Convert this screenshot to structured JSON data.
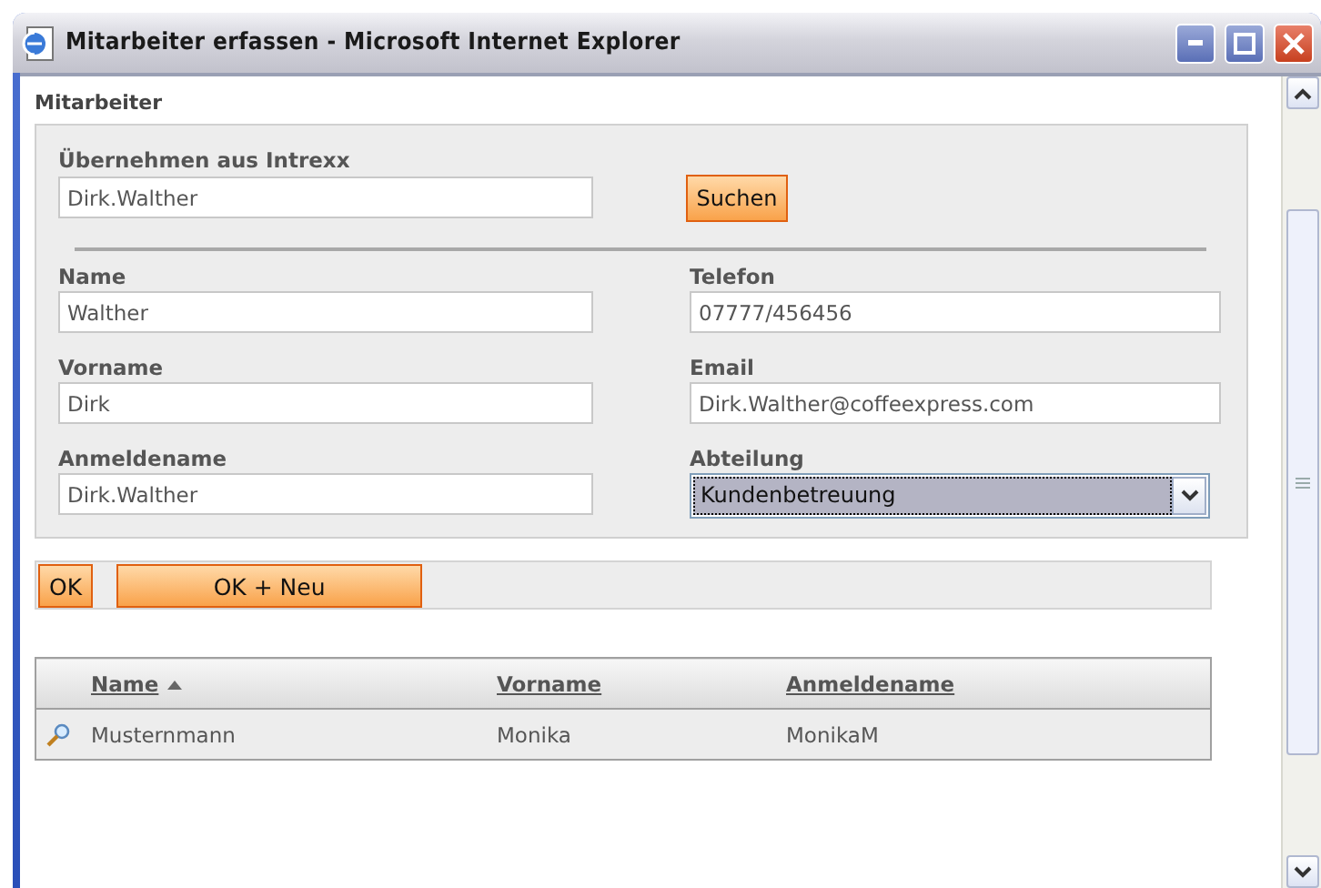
{
  "window": {
    "title": "Mitarbeiter erfassen - Microsoft Internet Explorer"
  },
  "section_title": "Mitarbeiter",
  "import": {
    "label": "Übernehmen aus Intrexx",
    "value": "Dirk.Walther",
    "button": "Suchen"
  },
  "fields": [
    {
      "label": "Name",
      "value": "Walther",
      "kind": "text"
    },
    {
      "label": "Telefon",
      "value": "07777/456456",
      "kind": "text"
    },
    {
      "label": "Vorname",
      "value": "Dirk",
      "kind": "text"
    },
    {
      "label": "Email",
      "value": "Dirk.Walther@coffeexpress.com",
      "kind": "text"
    },
    {
      "label": "Anmeldename",
      "value": "Dirk.Walther",
      "kind": "text"
    },
    {
      "label": "Abteilung",
      "value": "Kundenbetreuung",
      "kind": "select"
    }
  ],
  "buttons": [
    "OK",
    "OK + Neu"
  ],
  "table": {
    "columns": [
      {
        "label": "Name",
        "sorted": true
      },
      {
        "label": "Vorname",
        "sorted": false
      },
      {
        "label": "Anmeldename",
        "sorted": false
      }
    ],
    "rows": [
      [
        "Musternmann",
        "Monika",
        "MonikaM"
      ]
    ]
  }
}
